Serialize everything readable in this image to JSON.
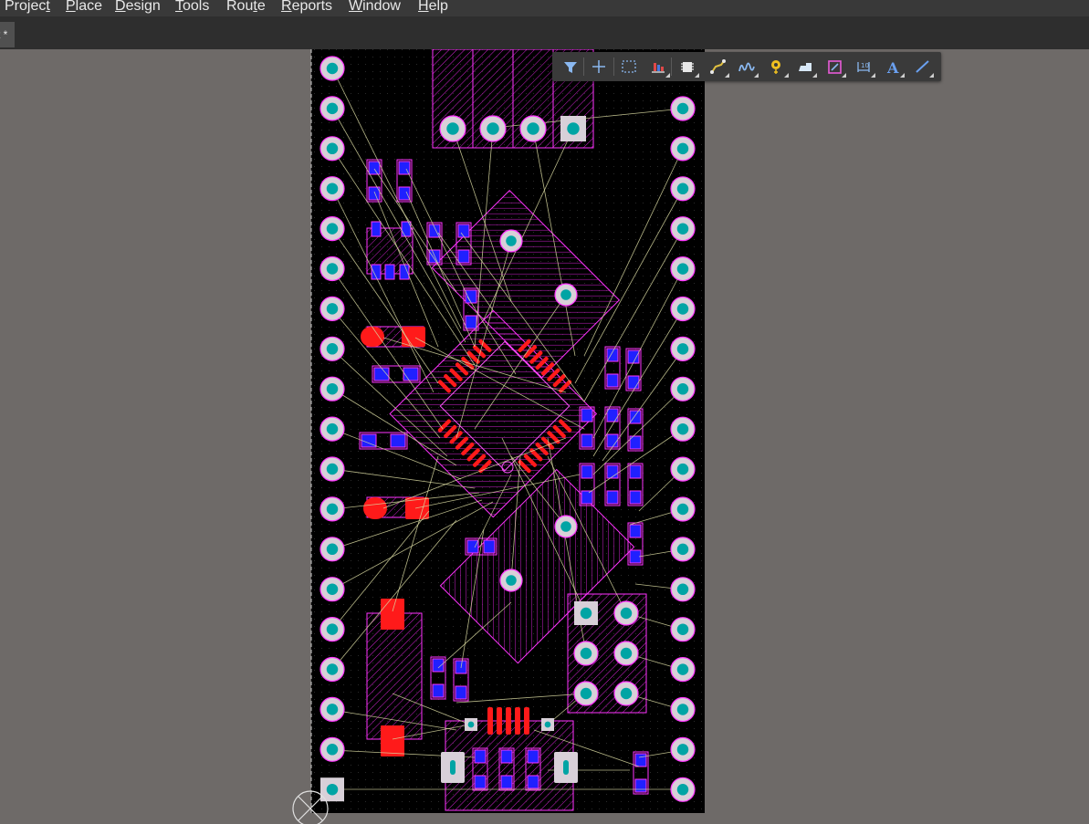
{
  "menubar": {
    "items": [
      {
        "label": "Project",
        "mnemonic_index": 6
      },
      {
        "label": "Place",
        "mnemonic_index": 0
      },
      {
        "label": "Design",
        "mnemonic_index": 0
      },
      {
        "label": "Tools",
        "mnemonic_index": 0
      },
      {
        "label": "Route",
        "mnemonic_index": 3
      },
      {
        "label": "Reports",
        "mnemonic_index": 0
      },
      {
        "label": "Window",
        "mnemonic_index": 0
      },
      {
        "label": "Help",
        "mnemonic_index": 0
      }
    ]
  },
  "document_tab": {
    "label": "t *"
  },
  "active_bar": {
    "buttons": [
      {
        "icon": "filter-icon"
      },
      {
        "icon": "crosshair-icon"
      },
      {
        "icon": "select-rectangle-icon"
      },
      {
        "icon": "align-icon"
      },
      {
        "icon": "component-icon"
      },
      {
        "icon": "interactive-routing-icon"
      },
      {
        "icon": "tune-length-icon"
      },
      {
        "icon": "via-icon"
      },
      {
        "icon": "polygon-pour-icon"
      },
      {
        "icon": "keepout-icon"
      },
      {
        "icon": "dimension-icon"
      },
      {
        "icon": "string-icon"
      },
      {
        "icon": "line-icon"
      }
    ]
  },
  "colors": {
    "board_background": "#000000",
    "pad_fill": "#00a4a4",
    "pad_ring": "#d8d0d8",
    "top_layer": "#ff1a1a",
    "bottom_layer": "#2020ff",
    "overlay": "#ff33ff",
    "ratsnest": "#d8d8a0",
    "workspace": "#6e6a68"
  }
}
